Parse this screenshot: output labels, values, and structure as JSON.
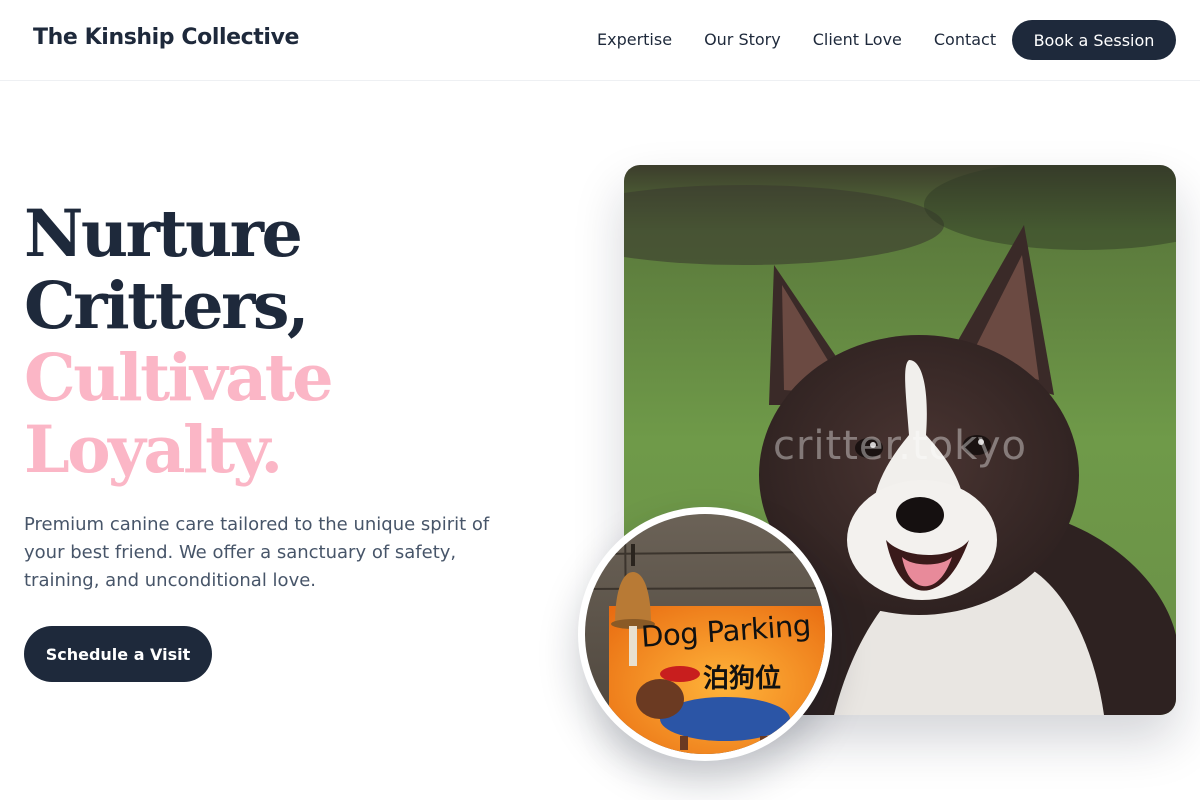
{
  "brand": {
    "name": "The Kinship Collective"
  },
  "nav": {
    "links": [
      "Expertise",
      "Our Story",
      "Client Love",
      "Contact"
    ],
    "cta_label": "Book a Session"
  },
  "hero": {
    "headline_line1": "Nurture",
    "headline_line2": "Critters,",
    "headline_line3": "Cultivate",
    "headline_line4": "Loyalty.",
    "lead": "Premium canine care tailored to the unique spirit of your best friend. We offer a sanctuary of safety, training, and unconditional love.",
    "cta_label": "Schedule a Visit"
  },
  "images": {
    "main_watermark": "critter.tokyo",
    "sign_text_en": "Dog Parking",
    "sign_text_cn": "泊狗位"
  },
  "colors": {
    "navy": "#1e293b",
    "pink": "#fbb6c6",
    "body_text": "#475569"
  }
}
